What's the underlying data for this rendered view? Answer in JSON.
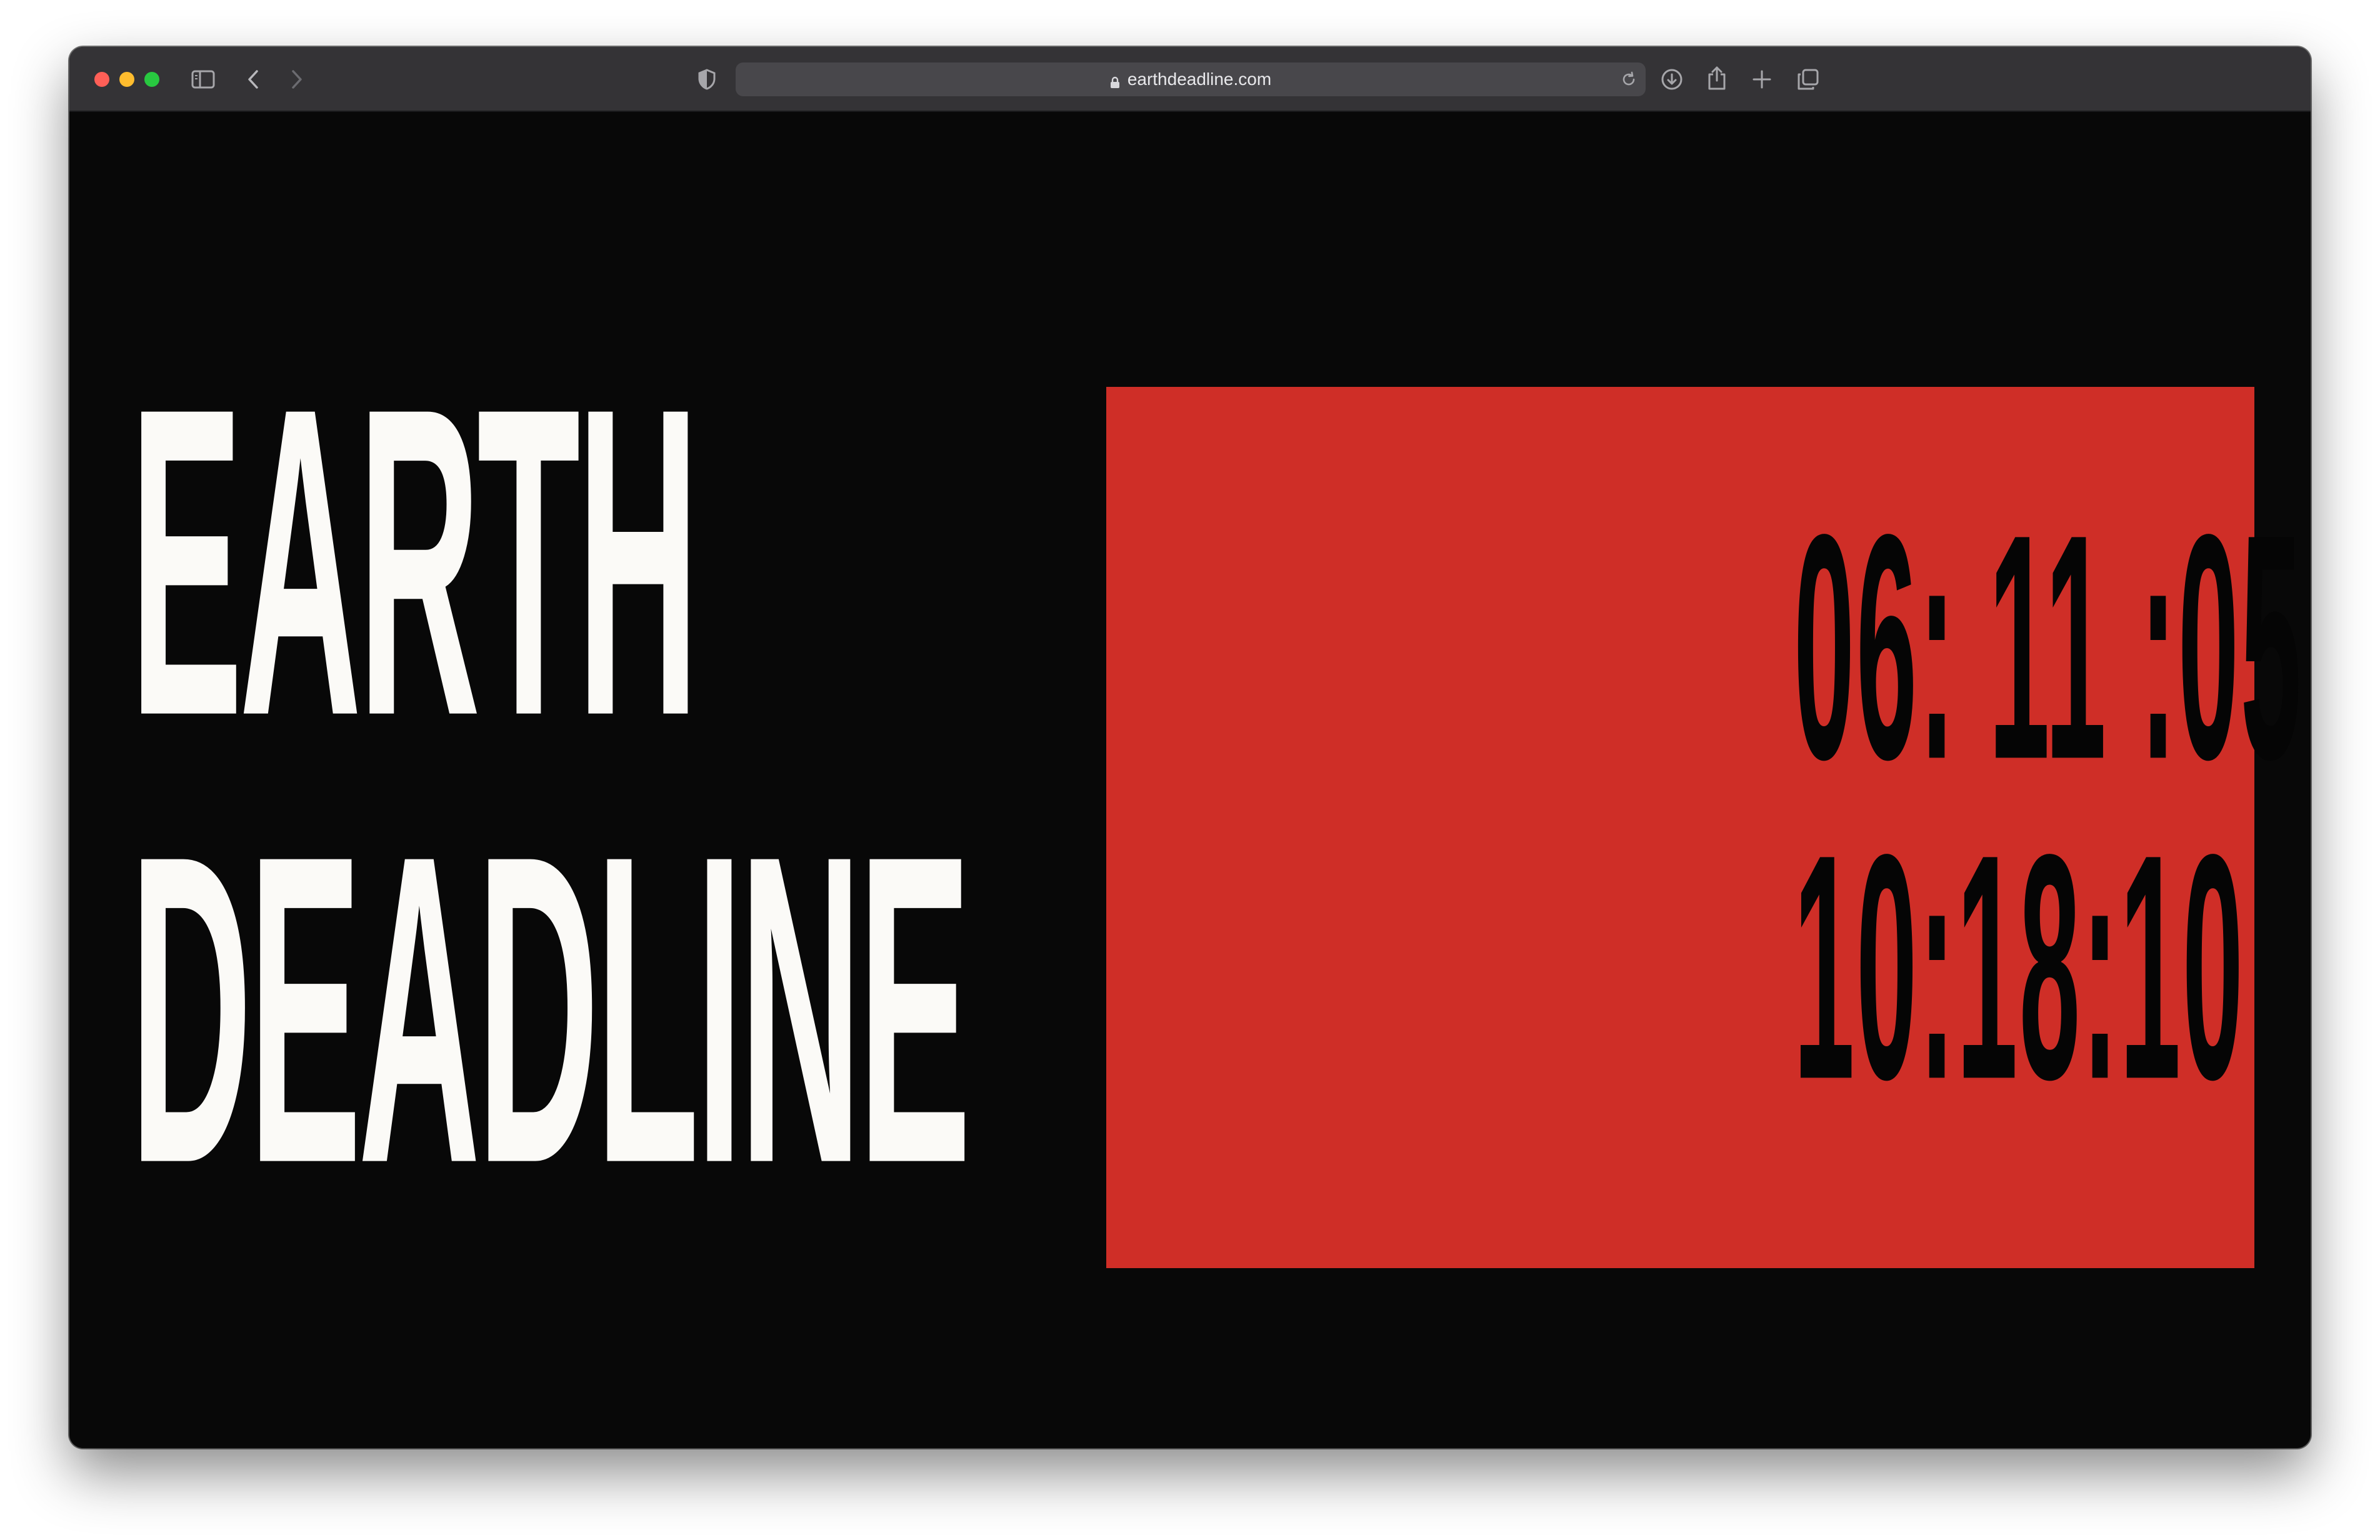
{
  "browser": {
    "url": "earthdeadline.com",
    "icons": {
      "sidebar": "sidebar-icon",
      "back": "chevron-left-icon",
      "forward": "chevron-right-icon",
      "privacy": "shield-icon",
      "lock": "lock-icon",
      "reload": "reload-icon",
      "download": "download-icon",
      "share": "share-icon",
      "new_tab": "plus-icon",
      "tabs": "tabs-overview-icon"
    },
    "traffic_lights": {
      "close": "#ff5f57",
      "minimize": "#febc2e",
      "zoom": "#28c840"
    }
  },
  "page": {
    "title_line1": "EARTH",
    "title_line2": "DEADLINE",
    "countdown_line1": "06: 11 :05",
    "countdown_line2": "10:18:10"
  },
  "colors": {
    "background": "#080808",
    "title": "#fbfaf7",
    "panel": "#cf2e27",
    "countdown": "#050505"
  }
}
